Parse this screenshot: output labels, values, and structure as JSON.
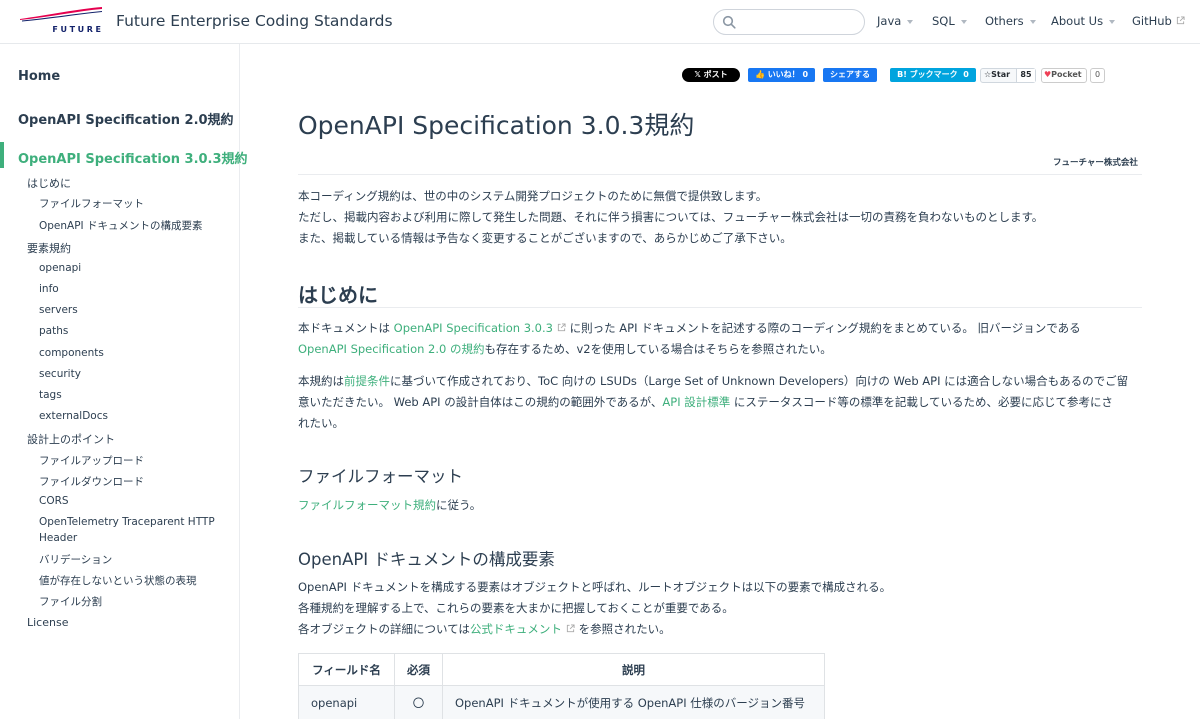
{
  "header": {
    "logo_text": "FUTURE",
    "site_title": "Future Enterprise Coding Standards",
    "search": {
      "placeholder": "",
      "value": ""
    },
    "nav": [
      {
        "label": "Java",
        "dropdown": true
      },
      {
        "label": "SQL",
        "dropdown": true
      },
      {
        "label": "Others",
        "dropdown": true
      },
      {
        "label": "About Us",
        "dropdown": true
      },
      {
        "label": "GitHub",
        "external": true
      }
    ]
  },
  "sidebar": {
    "top_items": [
      {
        "label": "Home"
      },
      {
        "label": "OpenAPI Specification 2.0規約"
      },
      {
        "label": "OpenAPI Specification 3.0.3規約",
        "active": true
      }
    ],
    "sections": [
      {
        "label": "はじめに",
        "children": [
          "ファイルフォーマット",
          "OpenAPI ドキュメントの構成要素"
        ]
      },
      {
        "label": "要素規約",
        "children": [
          "openapi",
          "info",
          "servers",
          "paths",
          "components",
          "security",
          "tags",
          "externalDocs"
        ]
      },
      {
        "label": "設計上のポイント",
        "children": [
          "ファイルアップロード",
          "ファイルダウンロード",
          "CORS",
          "OpenTelemetry Traceparent HTTP Header",
          "バリデーション",
          "値が存在しないという状態の表現",
          "ファイル分割"
        ]
      },
      {
        "label": "License",
        "children": []
      }
    ]
  },
  "share": {
    "x_label": "ポスト",
    "fb_like_label": "いいね！",
    "fb_like_count": "0",
    "fb_share_label": "シェアする",
    "hatena_label": "ブックマーク",
    "hatena_count": "0",
    "star_label": "Star",
    "star_count": "85",
    "pocket_label": "Pocket",
    "pocket_count": "0"
  },
  "content": {
    "title": "OpenAPI Specification 3.0.3規約",
    "author": "フューチャー株式会社",
    "disclaimer": [
      "本コーディング規約は、世の中のシステム開発プロジェクトのために無償で提供致します。",
      "ただし、掲載内容および利用に際して発生した問題、それに伴う損害については、フューチャー株式会社は一切の責務を負わないものとします。",
      "また、掲載している情報は予告なく変更することがございますので、あらかじめご了承下さい。"
    ],
    "intro_heading": "はじめに",
    "intro_p1": {
      "pre": "本ドキュメントは ",
      "link1": "OpenAPI Specification 3.0.3",
      "mid": " に則った API ドキュメントを記述する際のコーディング規約をまとめている。 旧バージョンである",
      "link2": "OpenAPI Specification 2.0 の規約",
      "post": "も存在するため、v2を使用している場合はそちらを参照されたい。"
    },
    "intro_p2": {
      "pre": "本規約は",
      "link1": "前提条件",
      "mid1": "に基づいて作成されており、ToC 向けの LSUDs（Large Set of Unknown Developers）向けの Web API には適合しない場合もあるのでご留",
      "mid2": "意いただきたい。 Web API の設計自体はこの規約の範囲外であるが、",
      "link2": "API 設計標準",
      "mid3": " にステータスコード等の標準を記載しているため、必要に応じて参考にさ",
      "post": "れたい。"
    },
    "fileformat_heading": "ファイルフォーマット",
    "fileformat_p": {
      "link": "ファイルフォーマット規約",
      "post": "に従う。"
    },
    "elements_heading": "OpenAPI ドキュメントの構成要素",
    "elements_p": {
      "line1": "OpenAPI ドキュメントを構成する要素はオブジェクトと呼ばれ、ルートオブジェクトは以下の要素で構成される。",
      "line2": "各種規約を理解する上で、これらの要素を大まかに把握しておくことが重要である。",
      "line3_pre": "各オブジェクトの詳細については",
      "line3_link": "公式ドキュメント",
      "line3_post": " を参照されたい。"
    },
    "table": {
      "headers": [
        "フィールド名",
        "必須",
        "説明"
      ],
      "rows": [
        [
          "openapi",
          "〇",
          "OpenAPI ドキュメントが使用する OpenAPI 仕様のバージョン番号"
        ]
      ]
    }
  },
  "colors": {
    "accent": "#3eaf7c",
    "text": "#2c3e50",
    "logo_red": "#e5004f",
    "logo_navy": "#14236b"
  }
}
